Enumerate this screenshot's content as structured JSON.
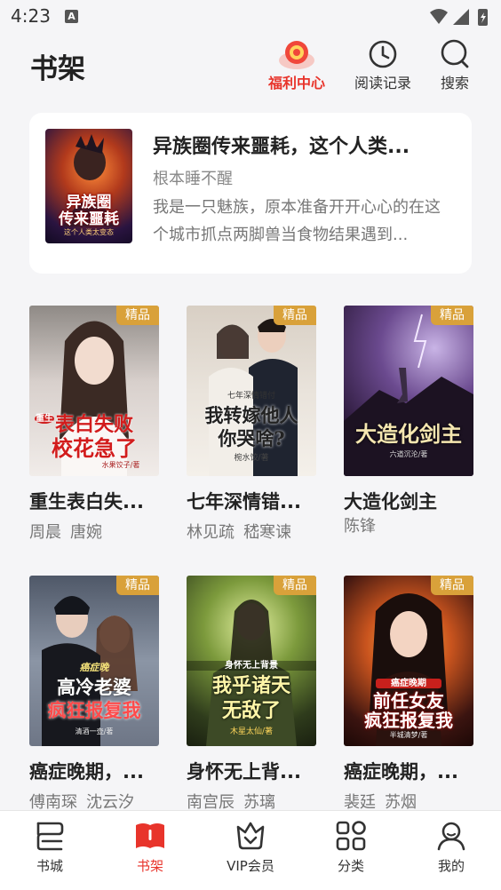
{
  "status_bar": {
    "time": "4:23",
    "notification_letter": "A"
  },
  "header": {
    "title": "书架",
    "actions": [
      {
        "label": "福利中心",
        "icon": "gift-coin-icon",
        "active": true
      },
      {
        "label": "阅读记录",
        "icon": "clock-icon",
        "active": false
      },
      {
        "label": "搜索",
        "icon": "search-icon",
        "active": false
      }
    ]
  },
  "featured": {
    "title": "异族圈传来噩耗，这个人类...",
    "author": "根本睡不醒",
    "description": "我是一只魅族，原本准备开开心心的在这个城市抓点两脚兽当食物结果遇到...",
    "cover_text": [
      "异族圈",
      "传来噩耗"
    ],
    "cover_subtext": "这个人类太变态"
  },
  "badge_label": "精品",
  "books": [
    {
      "title": "重生表白失...",
      "authors": [
        "周晨",
        "唐婉"
      ],
      "cover_text": [
        "表白失败",
        "校花急了"
      ],
      "cover_small": "水果饺子/著",
      "cover_tag": "重生"
    },
    {
      "title": "七年深情错...",
      "authors": [
        "林见疏",
        "嵇寒谏"
      ],
      "cover_text": [
        "我转嫁他人",
        "你哭啥?"
      ],
      "cover_small": "椀水饺/著",
      "cover_tag": "七年深情错付"
    },
    {
      "title": "大造化剑主",
      "authors": [
        "陈锋"
      ],
      "cover_text": [
        "大造化剑主"
      ],
      "cover_small": "六道沉沦/著",
      "cover_tag": ""
    },
    {
      "title": "癌症晚期，...",
      "authors": [
        "傅南琛",
        "沈云汐"
      ],
      "cover_text": [
        "高冷老婆",
        "疯狂报复我"
      ],
      "cover_small": "清酒一壶/著",
      "cover_tag": "癌症晚"
    },
    {
      "title": "身怀无上背...",
      "authors": [
        "南宫辰",
        "苏璃"
      ],
      "cover_text": [
        "我乎诸天",
        "无敌了"
      ],
      "cover_small": "木星太仙/著",
      "cover_tag": "身怀无上背景"
    },
    {
      "title": "癌症晚期，...",
      "authors": [
        "裴廷",
        "苏烟"
      ],
      "cover_text": [
        "前任女友",
        "疯狂报复我"
      ],
      "cover_small": "半城清梦/著",
      "cover_tag": "癌症晚期"
    }
  ],
  "bottom_nav": [
    {
      "label": "书城",
      "icon": "bookstore-icon",
      "active": false
    },
    {
      "label": "书架",
      "icon": "bookshelf-icon",
      "active": true
    },
    {
      "label": "VIP会员",
      "icon": "vip-crown-icon",
      "active": false
    },
    {
      "label": "分类",
      "icon": "category-grid-icon",
      "active": false
    },
    {
      "label": "我的",
      "icon": "profile-icon",
      "active": false
    }
  ],
  "colors": {
    "accent": "#e8342b",
    "badge": "#d9a13a",
    "background": "#f5f5f7"
  }
}
